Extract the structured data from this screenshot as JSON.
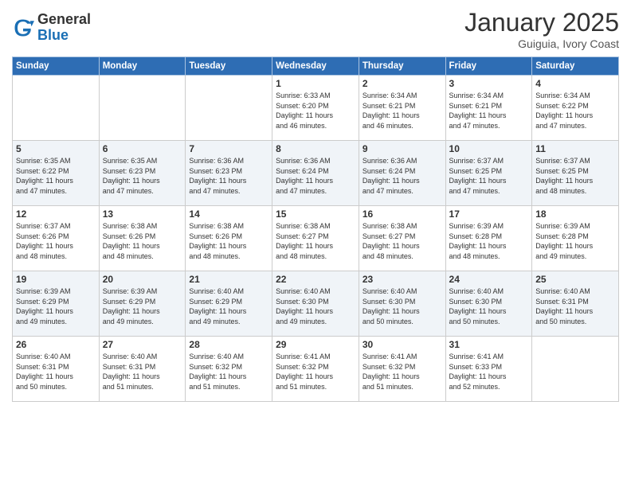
{
  "header": {
    "logo_line1": "General",
    "logo_line2": "Blue",
    "month": "January 2025",
    "location": "Guiguia, Ivory Coast"
  },
  "weekdays": [
    "Sunday",
    "Monday",
    "Tuesday",
    "Wednesday",
    "Thursday",
    "Friday",
    "Saturday"
  ],
  "weeks": [
    [
      {
        "day": "",
        "info": ""
      },
      {
        "day": "",
        "info": ""
      },
      {
        "day": "",
        "info": ""
      },
      {
        "day": "1",
        "info": "Sunrise: 6:33 AM\nSunset: 6:20 PM\nDaylight: 11 hours\nand 46 minutes."
      },
      {
        "day": "2",
        "info": "Sunrise: 6:34 AM\nSunset: 6:21 PM\nDaylight: 11 hours\nand 46 minutes."
      },
      {
        "day": "3",
        "info": "Sunrise: 6:34 AM\nSunset: 6:21 PM\nDaylight: 11 hours\nand 47 minutes."
      },
      {
        "day": "4",
        "info": "Sunrise: 6:34 AM\nSunset: 6:22 PM\nDaylight: 11 hours\nand 47 minutes."
      }
    ],
    [
      {
        "day": "5",
        "info": "Sunrise: 6:35 AM\nSunset: 6:22 PM\nDaylight: 11 hours\nand 47 minutes."
      },
      {
        "day": "6",
        "info": "Sunrise: 6:35 AM\nSunset: 6:23 PM\nDaylight: 11 hours\nand 47 minutes."
      },
      {
        "day": "7",
        "info": "Sunrise: 6:36 AM\nSunset: 6:23 PM\nDaylight: 11 hours\nand 47 minutes."
      },
      {
        "day": "8",
        "info": "Sunrise: 6:36 AM\nSunset: 6:24 PM\nDaylight: 11 hours\nand 47 minutes."
      },
      {
        "day": "9",
        "info": "Sunrise: 6:36 AM\nSunset: 6:24 PM\nDaylight: 11 hours\nand 47 minutes."
      },
      {
        "day": "10",
        "info": "Sunrise: 6:37 AM\nSunset: 6:25 PM\nDaylight: 11 hours\nand 47 minutes."
      },
      {
        "day": "11",
        "info": "Sunrise: 6:37 AM\nSunset: 6:25 PM\nDaylight: 11 hours\nand 48 minutes."
      }
    ],
    [
      {
        "day": "12",
        "info": "Sunrise: 6:37 AM\nSunset: 6:26 PM\nDaylight: 11 hours\nand 48 minutes."
      },
      {
        "day": "13",
        "info": "Sunrise: 6:38 AM\nSunset: 6:26 PM\nDaylight: 11 hours\nand 48 minutes."
      },
      {
        "day": "14",
        "info": "Sunrise: 6:38 AM\nSunset: 6:26 PM\nDaylight: 11 hours\nand 48 minutes."
      },
      {
        "day": "15",
        "info": "Sunrise: 6:38 AM\nSunset: 6:27 PM\nDaylight: 11 hours\nand 48 minutes."
      },
      {
        "day": "16",
        "info": "Sunrise: 6:38 AM\nSunset: 6:27 PM\nDaylight: 11 hours\nand 48 minutes."
      },
      {
        "day": "17",
        "info": "Sunrise: 6:39 AM\nSunset: 6:28 PM\nDaylight: 11 hours\nand 48 minutes."
      },
      {
        "day": "18",
        "info": "Sunrise: 6:39 AM\nSunset: 6:28 PM\nDaylight: 11 hours\nand 49 minutes."
      }
    ],
    [
      {
        "day": "19",
        "info": "Sunrise: 6:39 AM\nSunset: 6:29 PM\nDaylight: 11 hours\nand 49 minutes."
      },
      {
        "day": "20",
        "info": "Sunrise: 6:39 AM\nSunset: 6:29 PM\nDaylight: 11 hours\nand 49 minutes."
      },
      {
        "day": "21",
        "info": "Sunrise: 6:40 AM\nSunset: 6:29 PM\nDaylight: 11 hours\nand 49 minutes."
      },
      {
        "day": "22",
        "info": "Sunrise: 6:40 AM\nSunset: 6:30 PM\nDaylight: 11 hours\nand 49 minutes."
      },
      {
        "day": "23",
        "info": "Sunrise: 6:40 AM\nSunset: 6:30 PM\nDaylight: 11 hours\nand 50 minutes."
      },
      {
        "day": "24",
        "info": "Sunrise: 6:40 AM\nSunset: 6:30 PM\nDaylight: 11 hours\nand 50 minutes."
      },
      {
        "day": "25",
        "info": "Sunrise: 6:40 AM\nSunset: 6:31 PM\nDaylight: 11 hours\nand 50 minutes."
      }
    ],
    [
      {
        "day": "26",
        "info": "Sunrise: 6:40 AM\nSunset: 6:31 PM\nDaylight: 11 hours\nand 50 minutes."
      },
      {
        "day": "27",
        "info": "Sunrise: 6:40 AM\nSunset: 6:31 PM\nDaylight: 11 hours\nand 51 minutes."
      },
      {
        "day": "28",
        "info": "Sunrise: 6:40 AM\nSunset: 6:32 PM\nDaylight: 11 hours\nand 51 minutes."
      },
      {
        "day": "29",
        "info": "Sunrise: 6:41 AM\nSunset: 6:32 PM\nDaylight: 11 hours\nand 51 minutes."
      },
      {
        "day": "30",
        "info": "Sunrise: 6:41 AM\nSunset: 6:32 PM\nDaylight: 11 hours\nand 51 minutes."
      },
      {
        "day": "31",
        "info": "Sunrise: 6:41 AM\nSunset: 6:33 PM\nDaylight: 11 hours\nand 52 minutes."
      },
      {
        "day": "",
        "info": ""
      }
    ]
  ]
}
